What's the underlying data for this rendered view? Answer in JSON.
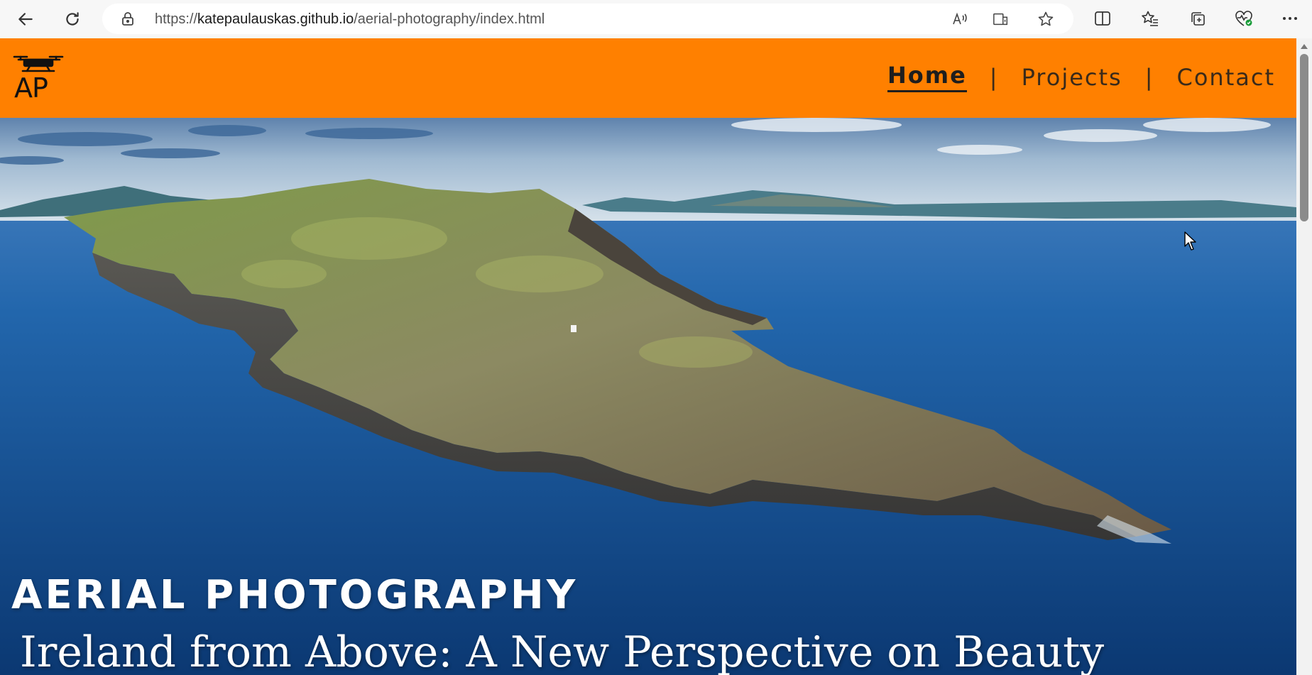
{
  "browser": {
    "url_prefix": "https://",
    "url_host": "katepaulauskas.github.io",
    "url_path": "/aerial-photography/index.html",
    "nav_icons": [
      "back-arrow-icon",
      "refresh-icon"
    ],
    "address_icons": [
      "read-aloud-icon",
      "immersive-reader-icon",
      "favorite-star-icon"
    ],
    "toolbar_icons": [
      "split-screen-icon",
      "favorites-icon",
      "collections-icon",
      "browser-essentials-icon",
      "more-icon"
    ]
  },
  "site": {
    "logo_text": "AP",
    "nav": [
      {
        "label": "Home",
        "active": true
      },
      {
        "label": "Projects",
        "active": false
      },
      {
        "label": "Contact",
        "active": false
      }
    ],
    "nav_separator": "|",
    "header_color": "#ff8000"
  },
  "hero": {
    "title": "AERIAL PHOTOGRAPHY",
    "subtitle": "Ireland from Above: A New Perspective on Beauty"
  }
}
